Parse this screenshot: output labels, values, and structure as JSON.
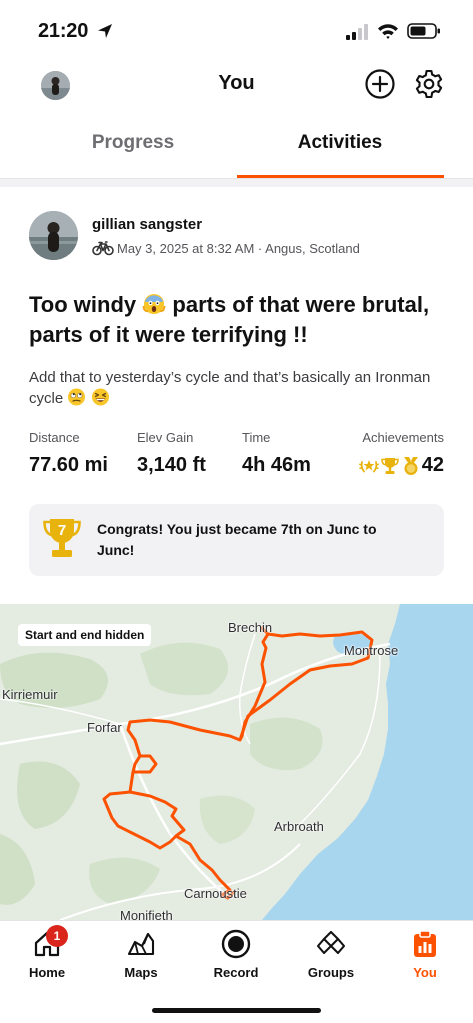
{
  "status_bar": {
    "time": "21:20"
  },
  "header": {
    "title": "You"
  },
  "tabs": [
    {
      "label": "Progress",
      "selected": false
    },
    {
      "label": "Activities",
      "selected": true
    }
  ],
  "activity": {
    "athlete_name": "gillian sangster",
    "meta": "May 3, 2025 at 8:32 AM · Angus, Scotland",
    "title_part1": "Too windy",
    "title_part2": "parts of that were brutal, parts of it were terrifying !!",
    "description": "Add that to yesterday’s cycle and that’s basically an Ironman cycle",
    "stats": {
      "distance_label": "Distance",
      "distance_value": "77.60 mi",
      "elev_label": "Elev Gain",
      "elev_value": "3,140 ft",
      "time_label": "Time",
      "time_value": "4h 46m",
      "achievements_label": "Achievements",
      "achievements_value": "42"
    },
    "congrats": {
      "rank": "7",
      "text": "Congrats! You just became 7th on Junc to Junc!"
    }
  },
  "map": {
    "badge": "Start and end hidden",
    "towns": {
      "brechin": "Brechin",
      "montrose": "Montrose",
      "kirriemuir": "Kirriemuir",
      "forfar": "Forfar",
      "arbroath": "Arbroath",
      "carnoustie": "Carnoustie",
      "monifieth": "Monifieth"
    }
  },
  "tabbar": {
    "home": "Home",
    "home_badge": "1",
    "maps": "Maps",
    "record": "Record",
    "groups": "Groups",
    "you": "You"
  },
  "colors": {
    "accent": "#fc5200",
    "badge": "#d9251c",
    "trophy_gold": "#e8b30c",
    "sea": "#a9d6ef",
    "land": "#e3ebdf"
  }
}
